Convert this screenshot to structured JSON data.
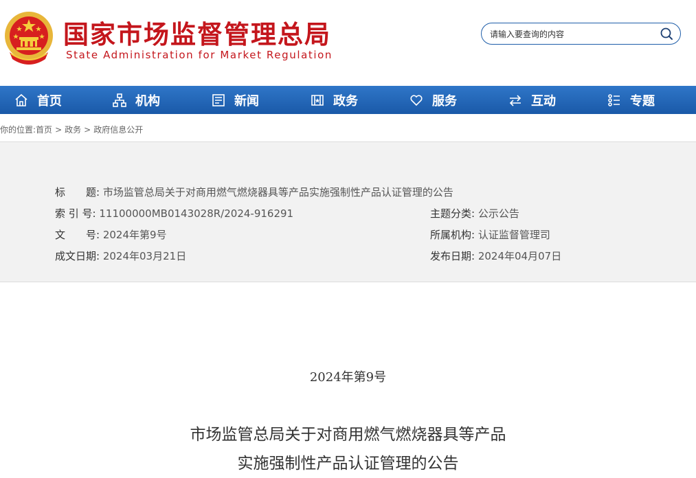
{
  "header": {
    "title_cn": "国家市场监督管理总局",
    "title_en": "State Administration for Market Regulation",
    "search_placeholder": "请输入要查询的内容"
  },
  "nav": {
    "items": [
      {
        "label": "首页",
        "icon": "home-icon"
      },
      {
        "label": "机构",
        "icon": "org-chart-icon"
      },
      {
        "label": "新闻",
        "icon": "newspaper-icon"
      },
      {
        "label": "政务",
        "icon": "government-icon"
      },
      {
        "label": "服务",
        "icon": "heart-icon"
      },
      {
        "label": "互动",
        "icon": "exchange-arrows-icon"
      },
      {
        "label": "专题",
        "icon": "topic-list-icon"
      }
    ]
  },
  "breadcrumb": {
    "prefix": "你的位置:",
    "items": [
      "首页",
      "政务",
      "政府信息公开"
    ],
    "separator": ">"
  },
  "info": {
    "title_label": "标　　题:",
    "title_value": "市场监管总局关于对商用燃气燃烧器具等产品实施强制性产品认证管理的公告",
    "index_label": "索 引 号:",
    "index_value": "11100000MB0143028R/2024-916291",
    "docnum_label": "文　　号:",
    "docnum_value": "2024年第9号",
    "date_label": "成文日期:",
    "date_value": "2024年03月21日",
    "topic_label": "主题分类:",
    "topic_value": "公示公告",
    "org_label": "所属机构:",
    "org_value": "认证监督管理司",
    "pub_label": "发布日期:",
    "pub_value": "2024年04月07日"
  },
  "article": {
    "doc_number": "2024年第9号",
    "title_line1": "市场监管总局关于对商用燃气燃烧器具等产品",
    "title_line2": "实施强制性产品认证管理的公告"
  },
  "colors": {
    "brand_red": "#c4161c",
    "nav_blue": "#1a59a8",
    "search_border": "#1c5ca8",
    "info_bg": "#f2f2f2"
  }
}
